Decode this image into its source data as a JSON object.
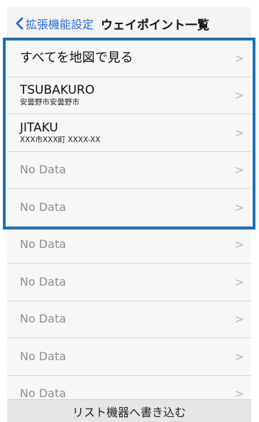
{
  "navbar": {
    "back_label": "拡張機能設定",
    "title": "ウェイポイント一覧"
  },
  "list": {
    "rows": [
      {
        "main": "すべてを地図で見る"
      },
      {
        "main": "TSUBAKURO",
        "sub": "安曇野市安曇野市"
      },
      {
        "main": "JITAKU",
        "sub": "XXX市XXX町 XXXX-XX"
      },
      {
        "main": "No Data"
      },
      {
        "main": "No Data"
      },
      {
        "main": "No Data"
      },
      {
        "main": "No Data"
      },
      {
        "main": "No Data"
      },
      {
        "main": "No Data"
      },
      {
        "main": "No Data"
      }
    ],
    "chevron": ">"
  },
  "footer": {
    "button_label": "リスト機器へ書き込む"
  },
  "colors": {
    "accent": "#2a6bd8",
    "highlight_border": "#1e6fb6"
  },
  "icons": {
    "back": "chevron-left-icon",
    "row": "chevron-right-icon"
  }
}
